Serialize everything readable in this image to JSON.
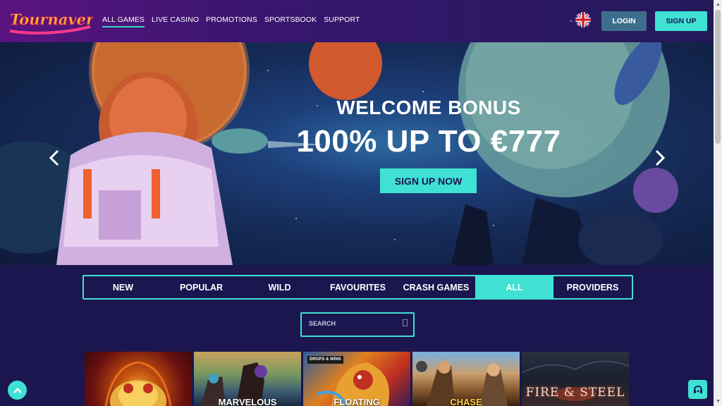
{
  "header": {
    "logo_text": "Tournaverse",
    "nav": [
      "ALL GAMES",
      "LIVE CASINO",
      "PROMOTIONS",
      "SPORTSBOOK",
      "SUPPORT"
    ],
    "active_nav": "ALL GAMES",
    "language_icon": "uk-flag-icon",
    "login_label": "LOGIN",
    "signup_label": "SIGN UP"
  },
  "hero": {
    "title": "WELCOME BONUS",
    "subtitle": "100% UP TO €777",
    "cta_label": "SIGN UP NOW",
    "prev_icon": "chevron-left-icon",
    "next_icon": "chevron-right-icon"
  },
  "tabs": [
    "NEW",
    "POPULAR",
    "WILD",
    "FAVOURITES",
    "CRASH GAMES",
    "ALL",
    "PROVIDERS"
  ],
  "active_tab": "ALL",
  "search": {
    "placeholder": "SEARCH"
  },
  "games": [
    {
      "title": ""
    },
    {
      "title": "MARVELOUS"
    },
    {
      "title": "FLOATING",
      "badge": "DROPS & WINS"
    },
    {
      "title": "CHASE"
    },
    {
      "title": "FIRE & STEEL"
    }
  ],
  "colors": {
    "accent": "#3ee1d3",
    "background": "#1b1650",
    "login_button": "#3f6e8c"
  }
}
